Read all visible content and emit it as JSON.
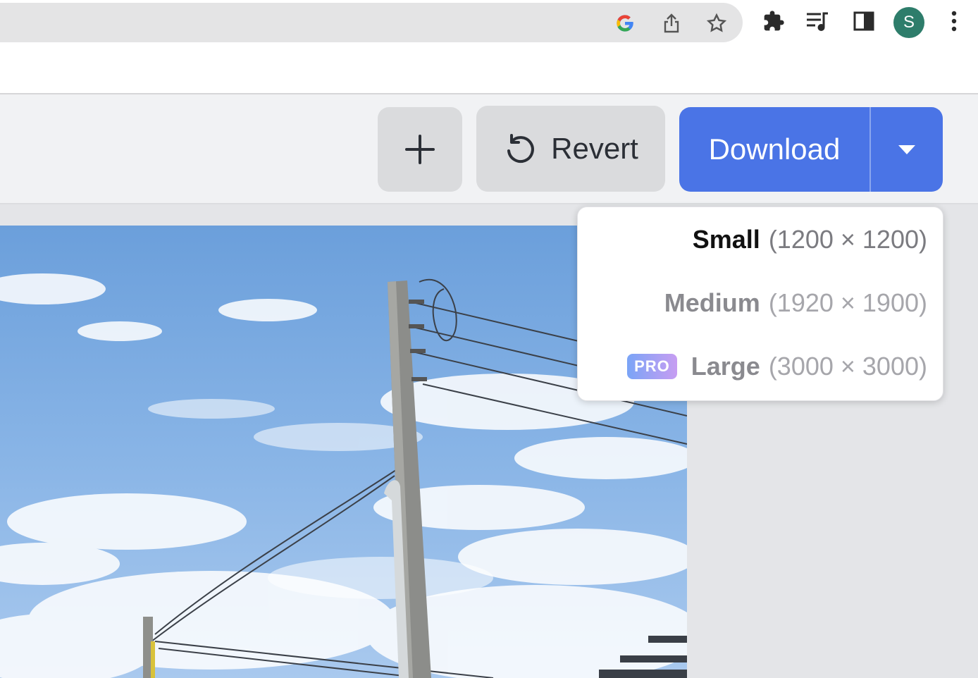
{
  "browser": {
    "icons": [
      "google-icon",
      "share-icon",
      "bookmark-star-icon",
      "extensions-icon",
      "media-control-icon",
      "side-panel-icon",
      "kebab-menu-icon"
    ],
    "profile_initial": "S",
    "profile_color": "#2e7d6b"
  },
  "toolbar": {
    "add_icon": "plus-icon",
    "revert_label": "Revert",
    "download_label": "Download",
    "accent_color": "#4a74e6"
  },
  "download_menu": {
    "items": [
      {
        "name": "Small",
        "dims": "(1200 × 1200)",
        "badge": ""
      },
      {
        "name": "Medium",
        "dims": "(1920 × 1900)",
        "badge": ""
      },
      {
        "name": "Large",
        "dims": "(3000 × 3000)",
        "badge": "PRO"
      }
    ]
  }
}
